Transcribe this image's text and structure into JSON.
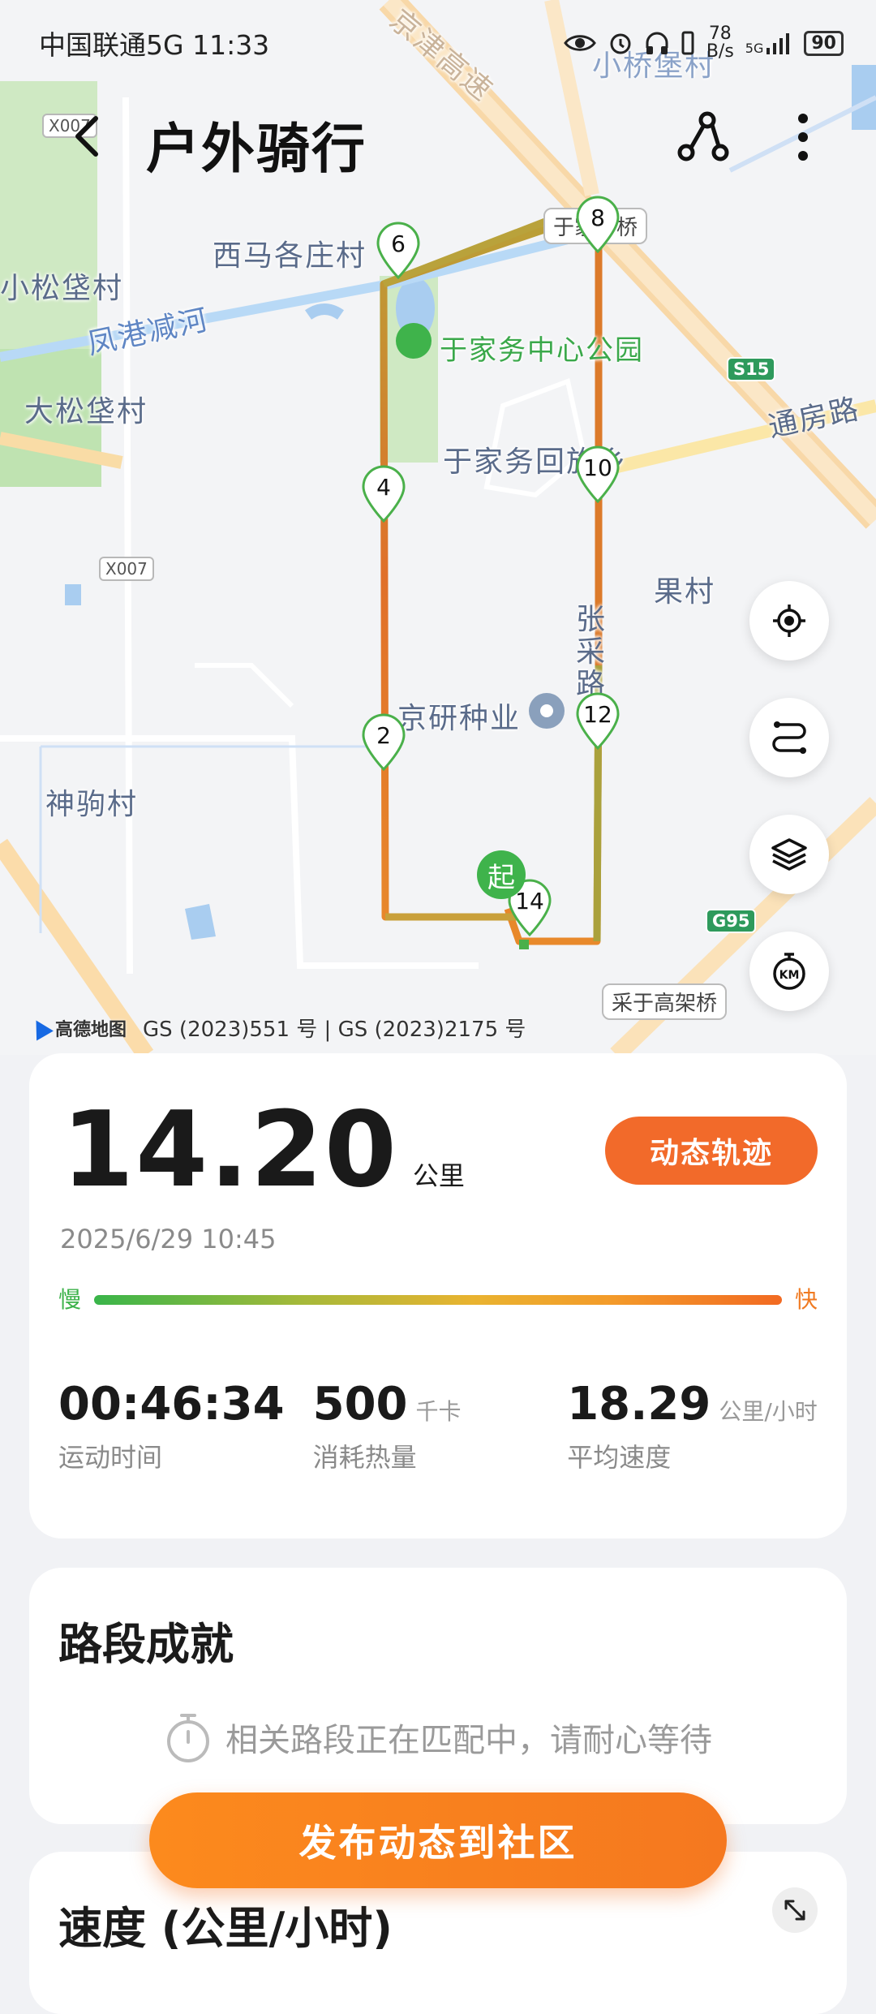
{
  "status_bar": {
    "carrier": "中国联通5G",
    "time": "11:33",
    "net_speed_top": "78",
    "net_speed_unit": "B/s",
    "signal_label": "5G",
    "battery": "90"
  },
  "header": {
    "title": "户外骑行"
  },
  "map": {
    "place_labels": {
      "xima": "西马各庄村",
      "xiaosong": "小松垡村",
      "fenggang": "凤港减河",
      "dasong": "大松垡村",
      "park": "于家务中心公园",
      "yujiawu": "于家务回族乡",
      "guocun": "果村",
      "jingyan": "京研种业",
      "shenju": "神驹村",
      "zhanglai": "张采路",
      "tongfang": "通房路",
      "jingjin": "京津高速",
      "zaoqiao": "小桥堡村"
    },
    "road_signs": {
      "x007a": "X007",
      "x007b": "X007",
      "s15": "S15",
      "g95": "G95"
    },
    "bridges": {
      "yijia": "于家一桥",
      "caiyu": "采于高架桥"
    },
    "km_markers": [
      "2",
      "4",
      "6",
      "8",
      "10",
      "12",
      "14"
    ],
    "start_label": "起",
    "copyright_logo": "高德地图",
    "copyright_text": "GS (2023)551 号 | GS (2023)2175 号",
    "route_color_slow": "#39b54a",
    "route_color_fast": "#f26a22"
  },
  "summary": {
    "distance": "14.20",
    "distance_unit": "公里",
    "dynamic_track_button": "动态轨迹",
    "datetime": "2025/6/29 10:45",
    "speed_slow": "慢",
    "speed_fast": "快",
    "stats": [
      {
        "value": "00:46:34",
        "unit": "",
        "label": "运动时间"
      },
      {
        "value": "500",
        "unit": "千卡",
        "label": "消耗热量"
      },
      {
        "value": "18.29",
        "unit": "公里/小时",
        "label": "平均速度"
      }
    ]
  },
  "achievements": {
    "title": "路段成就",
    "matching_text": "相关路段正在匹配中，请耐心等待"
  },
  "speed_section": {
    "title": "速度 (公里/小时)"
  },
  "publish_button": "发布动态到社区"
}
